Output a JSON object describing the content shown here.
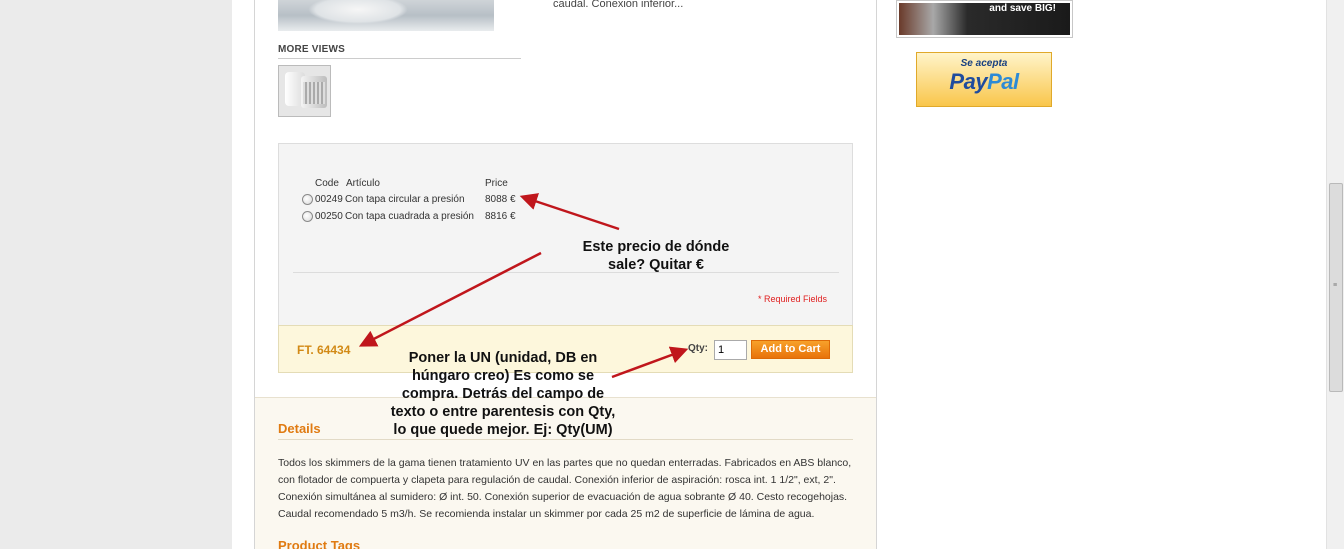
{
  "product": {
    "short_desc": "caudal. Conexion inferior...",
    "more_views_label": "MORE VIEWS"
  },
  "options": {
    "header_code": "Code",
    "header_article": "Artículo",
    "header_price": "Price",
    "rows": [
      {
        "code": "00249",
        "name": "Con tapa circular a presión",
        "price": "8088 €"
      },
      {
        "code": "00250",
        "name": "Con tapa cuadrada a presión",
        "price": "8816 €"
      }
    ],
    "required_label": "* Required Fields"
  },
  "cart": {
    "ft_code": "FT. 64434",
    "qty_label": "Qty:",
    "qty_value": "1",
    "add_to_cart_label": "Add to Cart"
  },
  "details": {
    "title": "Details",
    "text": "Todos los skimmers de la gama tienen tratamiento UV en las partes que no quedan enterradas. Fabricados en ABS blanco, con flotador de compuerta y clapeta para regulación de caudal. Conexión inferior de aspiración: rosca int. 1 1/2\", ext, 2\". Conexión simultánea al sumidero: Ø int. 50. Conexión superior de evacuación de agua sobrante Ø 40. Cesto recogehojas. Caudal recomendado 5 m3/h. Se recomienda instalar un skimmer por cada 25 m2 de superficie de lámina de agua.",
    "tags_title": "Product Tags"
  },
  "sidebar": {
    "banner_text": "and save BIG!",
    "paypal_accept": "Se acepta",
    "paypal_pay": "Pay",
    "paypal_pal": "Pal"
  },
  "annotations": {
    "note1": "Este precio de dónde sale? Quitar €",
    "note2": "Poner la UN (unidad, DB en húngaro creo) Es como se compra. Detrás del campo de texto o entre parentesis con Qty, lo que quede mejor. Ej: Qty(UM)"
  },
  "colors": {
    "accent_orange": "#e07b12",
    "arrow_red": "#c0161c",
    "button_orange": "#f08a1a"
  }
}
